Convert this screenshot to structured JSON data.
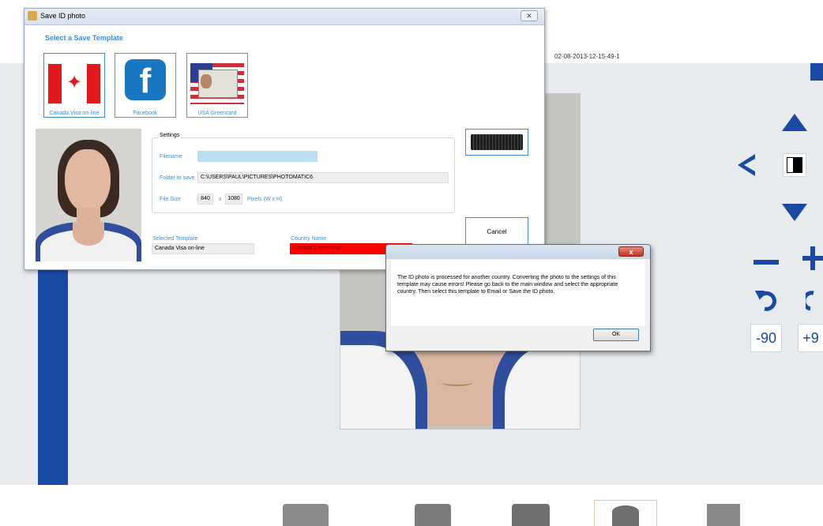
{
  "background": {
    "filename": "02-08-2013-12-15-49-1",
    "tools": {
      "rotate_minus_label": "-90",
      "rotate_plus_label": "+9"
    }
  },
  "dialog": {
    "title": "Save ID photo",
    "close_glyph": "✕",
    "heading": "Select a Save Template",
    "templates": [
      {
        "label": "Canada Visa on-line",
        "selected": true
      },
      {
        "label": "Facebook",
        "selected": false
      },
      {
        "label": "USA Greencard",
        "selected": false
      }
    ],
    "settings": {
      "legend": "Settings",
      "filename_label": "Filename",
      "filename_value": "",
      "folder_label": "Folder to save",
      "folder_value": "C:\\USERS\\PAUL\\PICTURES\\PHOTOMATIC6",
      "filesize_label": "File Size",
      "width": "840",
      "times": "x",
      "height": "1080",
      "units": "Pixels (W x H)"
    },
    "selected_template_label": "Selected Template",
    "selected_template_value": "Canada Visa on-line",
    "country_name_label": "Country Name",
    "country_name_value": "Canada Citizenship",
    "cancel_label": "Cancel"
  },
  "message_box": {
    "close_glyph": "x",
    "text": "The ID photo is processed for another country. Converting the photo to the settings of this template may cause errors! Please go back to the main window and select the appropriate country. Then select this template to Email or Save the ID photo.",
    "ok_label": "OK"
  },
  "colors": {
    "accent_blue": "#1a4aa3",
    "link_blue": "#3a8dde",
    "error_red": "#ff0000"
  },
  "icons": [
    "maple-leaf-icon",
    "facebook-icon",
    "greencard-icon",
    "keyboard-icon",
    "arrow-up-icon",
    "arrow-left-icon",
    "arrow-down-icon",
    "contrast-icon",
    "zoom-out-icon",
    "zoom-in-icon",
    "rotate-left-icon",
    "rotate-right-icon",
    "usb-icon",
    "scanner-icon",
    "printer-icon",
    "database-icon",
    "email-icon"
  ]
}
